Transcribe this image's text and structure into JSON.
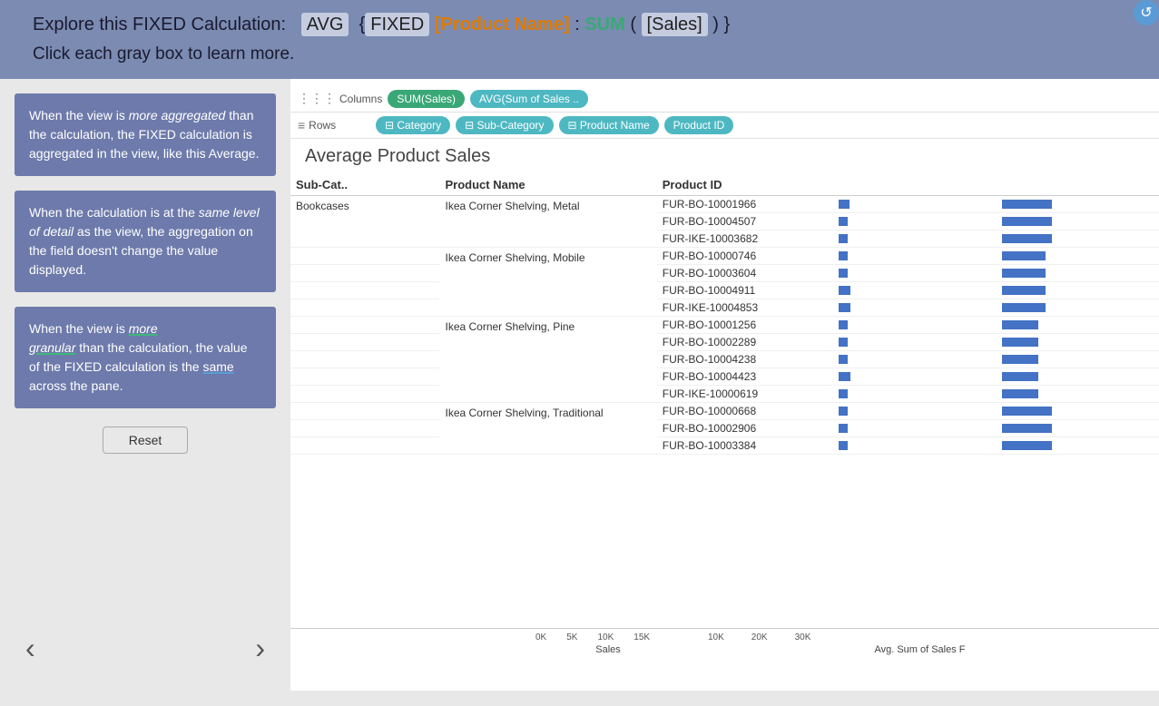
{
  "header": {
    "line1_prefix": "Explore this FIXED Calculation:",
    "formula_display": "AVG {FIXED [Product Name] : SUM ( [Sales] ) }",
    "line2": "Click each gray box to learn more.",
    "reload_label": "↺"
  },
  "info_boxes": [
    {
      "id": "box1",
      "text_parts": [
        "When the view is ",
        "more aggregated",
        " than the calculation, the FIXED calculation is aggregated in the view, like this Average."
      ]
    },
    {
      "id": "box2",
      "text_parts": [
        "When the calculation is at the ",
        "same level of detail",
        " as the view, the aggregation on the field doesn't change the value displayed."
      ]
    },
    {
      "id": "box3",
      "text_parts": [
        "When the view is ",
        "more granular",
        " than the calculation, the value of the FIXED calculation is the ",
        "same",
        " across the pane."
      ]
    }
  ],
  "reset_button": "Reset",
  "nav": {
    "prev": "‹",
    "next": "›"
  },
  "tableau": {
    "columns_label": "Columns",
    "rows_label": "Rows",
    "columns_pills": [
      {
        "label": "SUM(Sales)",
        "type": "green"
      },
      {
        "label": "AVG(Sum of Sales ..",
        "type": "teal"
      }
    ],
    "rows_pills": [
      {
        "label": "Category",
        "type": "teal",
        "icon": "⊟"
      },
      {
        "label": "Sub-Category",
        "type": "teal",
        "icon": "⊟"
      },
      {
        "label": "Product Name",
        "type": "teal",
        "icon": "⊟"
      },
      {
        "label": "Product ID",
        "type": "teal",
        "icon": ""
      }
    ],
    "chart_title": "Average Product Sales",
    "table_headers": [
      "Sub-Cat..",
      "Product Name",
      "Product ID",
      "",
      ""
    ],
    "rows": [
      {
        "subcat": "Bookcases",
        "product": "Ikea Corner Shelving, Metal",
        "ids": [
          "FUR-BO-10001966",
          "FUR-BO-10004507",
          "FUR-IKE-10003682"
        ],
        "bars1": [
          3,
          3,
          3
        ],
        "bars2": [
          16,
          16,
          16
        ]
      },
      {
        "subcat": "",
        "product": "Ikea Corner Shelving, Mobile",
        "ids": [
          "FUR-BO-10000746",
          "FUR-BO-10003604",
          "FUR-BO-10004911",
          "FUR-IKE-10004853"
        ],
        "bars1": [
          3,
          3,
          4,
          4
        ],
        "bars2": [
          14,
          14,
          14,
          14
        ]
      },
      {
        "subcat": "",
        "product": "Ikea Corner Shelving, Pine",
        "ids": [
          "FUR-BO-10001256",
          "FUR-BO-10002289",
          "FUR-BO-10004238",
          "FUR-BO-10004423",
          "FUR-IKE-10000619"
        ],
        "bars1": [
          3,
          3,
          3,
          4,
          3
        ],
        "bars2": [
          12,
          12,
          12,
          12,
          12
        ]
      },
      {
        "subcat": "",
        "product": "Ikea Corner Shelving, Traditional",
        "ids": [
          "FUR-BO-10000668",
          "FUR-BO-10002906",
          "FUR-BO-10003384"
        ],
        "bars1": [
          3,
          3,
          3
        ],
        "bars2": [
          16,
          16,
          16
        ]
      }
    ],
    "axis1": {
      "labels": [
        "0K",
        "5K",
        "10K",
        "15K"
      ],
      "title": "Sales"
    },
    "axis2": {
      "labels": [
        "10K",
        "20K",
        "30K"
      ],
      "title": "Avg. Sum of Sales F"
    }
  }
}
